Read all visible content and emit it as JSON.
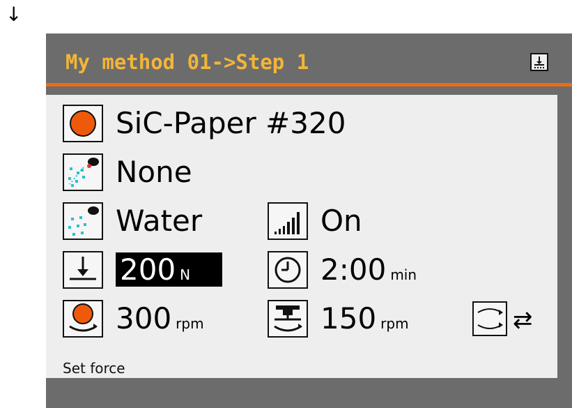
{
  "top_arrow": "↓",
  "header": {
    "title": "My method 01->Step 1"
  },
  "rows": {
    "surface": {
      "value": "SiC-Paper #320"
    },
    "suspension": {
      "value": "None"
    },
    "lubricant": {
      "value": "Water"
    },
    "lubricant_level": {
      "value": "On"
    },
    "force": {
      "value": "200",
      "unit": "N"
    },
    "time": {
      "value": "2:00",
      "unit": "min"
    },
    "disc_speed": {
      "value": "300",
      "unit": "rpm"
    },
    "head_speed": {
      "value": "150",
      "unit": "rpm"
    },
    "direction": {
      "value": "⇄"
    }
  },
  "status": "Set force",
  "colors": {
    "accent": "#ef6a16",
    "title": "#f2b53a",
    "panel": "#6c6c6c",
    "content": "#eeeeee"
  }
}
